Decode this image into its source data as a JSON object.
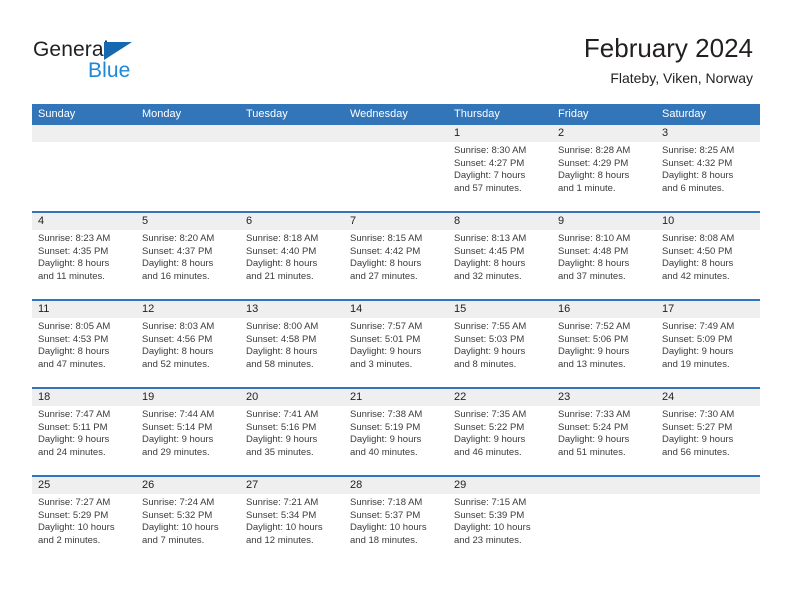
{
  "brand": {
    "word_one": "General",
    "word_two": "Blue",
    "triangle_color": "#1469b0",
    "blue_text_color": "#1d87d8"
  },
  "header": {
    "title": "February 2024",
    "location": "Flateby, Viken, Norway"
  },
  "theme": {
    "header_band": "#3275b8",
    "daynum_band": "#efefef",
    "week_divider": "#3275b8",
    "text": "#231f20"
  },
  "weekday_headers": [
    "Sunday",
    "Monday",
    "Tuesday",
    "Wednesday",
    "Thursday",
    "Friday",
    "Saturday"
  ],
  "weeks": [
    [
      {
        "day": "",
        "sunrise": "",
        "sunset": "",
        "daylight_line1": "",
        "daylight_line2": "",
        "empty": true
      },
      {
        "day": "",
        "sunrise": "",
        "sunset": "",
        "daylight_line1": "",
        "daylight_line2": "",
        "empty": true
      },
      {
        "day": "",
        "sunrise": "",
        "sunset": "",
        "daylight_line1": "",
        "daylight_line2": "",
        "empty": true
      },
      {
        "day": "",
        "sunrise": "",
        "sunset": "",
        "daylight_line1": "",
        "daylight_line2": "",
        "empty": true
      },
      {
        "day": "1",
        "sunrise": "Sunrise: 8:30 AM",
        "sunset": "Sunset: 4:27 PM",
        "daylight_line1": "Daylight: 7 hours",
        "daylight_line2": "and 57 minutes."
      },
      {
        "day": "2",
        "sunrise": "Sunrise: 8:28 AM",
        "sunset": "Sunset: 4:29 PM",
        "daylight_line1": "Daylight: 8 hours",
        "daylight_line2": "and 1 minute."
      },
      {
        "day": "3",
        "sunrise": "Sunrise: 8:25 AM",
        "sunset": "Sunset: 4:32 PM",
        "daylight_line1": "Daylight: 8 hours",
        "daylight_line2": "and 6 minutes."
      }
    ],
    [
      {
        "day": "4",
        "sunrise": "Sunrise: 8:23 AM",
        "sunset": "Sunset: 4:35 PM",
        "daylight_line1": "Daylight: 8 hours",
        "daylight_line2": "and 11 minutes."
      },
      {
        "day": "5",
        "sunrise": "Sunrise: 8:20 AM",
        "sunset": "Sunset: 4:37 PM",
        "daylight_line1": "Daylight: 8 hours",
        "daylight_line2": "and 16 minutes."
      },
      {
        "day": "6",
        "sunrise": "Sunrise: 8:18 AM",
        "sunset": "Sunset: 4:40 PM",
        "daylight_line1": "Daylight: 8 hours",
        "daylight_line2": "and 21 minutes."
      },
      {
        "day": "7",
        "sunrise": "Sunrise: 8:15 AM",
        "sunset": "Sunset: 4:42 PM",
        "daylight_line1": "Daylight: 8 hours",
        "daylight_line2": "and 27 minutes."
      },
      {
        "day": "8",
        "sunrise": "Sunrise: 8:13 AM",
        "sunset": "Sunset: 4:45 PM",
        "daylight_line1": "Daylight: 8 hours",
        "daylight_line2": "and 32 minutes."
      },
      {
        "day": "9",
        "sunrise": "Sunrise: 8:10 AM",
        "sunset": "Sunset: 4:48 PM",
        "daylight_line1": "Daylight: 8 hours",
        "daylight_line2": "and 37 minutes."
      },
      {
        "day": "10",
        "sunrise": "Sunrise: 8:08 AM",
        "sunset": "Sunset: 4:50 PM",
        "daylight_line1": "Daylight: 8 hours",
        "daylight_line2": "and 42 minutes."
      }
    ],
    [
      {
        "day": "11",
        "sunrise": "Sunrise: 8:05 AM",
        "sunset": "Sunset: 4:53 PM",
        "daylight_line1": "Daylight: 8 hours",
        "daylight_line2": "and 47 minutes."
      },
      {
        "day": "12",
        "sunrise": "Sunrise: 8:03 AM",
        "sunset": "Sunset: 4:56 PM",
        "daylight_line1": "Daylight: 8 hours",
        "daylight_line2": "and 52 minutes."
      },
      {
        "day": "13",
        "sunrise": "Sunrise: 8:00 AM",
        "sunset": "Sunset: 4:58 PM",
        "daylight_line1": "Daylight: 8 hours",
        "daylight_line2": "and 58 minutes."
      },
      {
        "day": "14",
        "sunrise": "Sunrise: 7:57 AM",
        "sunset": "Sunset: 5:01 PM",
        "daylight_line1": "Daylight: 9 hours",
        "daylight_line2": "and 3 minutes."
      },
      {
        "day": "15",
        "sunrise": "Sunrise: 7:55 AM",
        "sunset": "Sunset: 5:03 PM",
        "daylight_line1": "Daylight: 9 hours",
        "daylight_line2": "and 8 minutes."
      },
      {
        "day": "16",
        "sunrise": "Sunrise: 7:52 AM",
        "sunset": "Sunset: 5:06 PM",
        "daylight_line1": "Daylight: 9 hours",
        "daylight_line2": "and 13 minutes."
      },
      {
        "day": "17",
        "sunrise": "Sunrise: 7:49 AM",
        "sunset": "Sunset: 5:09 PM",
        "daylight_line1": "Daylight: 9 hours",
        "daylight_line2": "and 19 minutes."
      }
    ],
    [
      {
        "day": "18",
        "sunrise": "Sunrise: 7:47 AM",
        "sunset": "Sunset: 5:11 PM",
        "daylight_line1": "Daylight: 9 hours",
        "daylight_line2": "and 24 minutes."
      },
      {
        "day": "19",
        "sunrise": "Sunrise: 7:44 AM",
        "sunset": "Sunset: 5:14 PM",
        "daylight_line1": "Daylight: 9 hours",
        "daylight_line2": "and 29 minutes."
      },
      {
        "day": "20",
        "sunrise": "Sunrise: 7:41 AM",
        "sunset": "Sunset: 5:16 PM",
        "daylight_line1": "Daylight: 9 hours",
        "daylight_line2": "and 35 minutes."
      },
      {
        "day": "21",
        "sunrise": "Sunrise: 7:38 AM",
        "sunset": "Sunset: 5:19 PM",
        "daylight_line1": "Daylight: 9 hours",
        "daylight_line2": "and 40 minutes."
      },
      {
        "day": "22",
        "sunrise": "Sunrise: 7:35 AM",
        "sunset": "Sunset: 5:22 PM",
        "daylight_line1": "Daylight: 9 hours",
        "daylight_line2": "and 46 minutes."
      },
      {
        "day": "23",
        "sunrise": "Sunrise: 7:33 AM",
        "sunset": "Sunset: 5:24 PM",
        "daylight_line1": "Daylight: 9 hours",
        "daylight_line2": "and 51 minutes."
      },
      {
        "day": "24",
        "sunrise": "Sunrise: 7:30 AM",
        "sunset": "Sunset: 5:27 PM",
        "daylight_line1": "Daylight: 9 hours",
        "daylight_line2": "and 56 minutes."
      }
    ],
    [
      {
        "day": "25",
        "sunrise": "Sunrise: 7:27 AM",
        "sunset": "Sunset: 5:29 PM",
        "daylight_line1": "Daylight: 10 hours",
        "daylight_line2": "and 2 minutes."
      },
      {
        "day": "26",
        "sunrise": "Sunrise: 7:24 AM",
        "sunset": "Sunset: 5:32 PM",
        "daylight_line1": "Daylight: 10 hours",
        "daylight_line2": "and 7 minutes."
      },
      {
        "day": "27",
        "sunrise": "Sunrise: 7:21 AM",
        "sunset": "Sunset: 5:34 PM",
        "daylight_line1": "Daylight: 10 hours",
        "daylight_line2": "and 12 minutes."
      },
      {
        "day": "28",
        "sunrise": "Sunrise: 7:18 AM",
        "sunset": "Sunset: 5:37 PM",
        "daylight_line1": "Daylight: 10 hours",
        "daylight_line2": "and 18 minutes."
      },
      {
        "day": "29",
        "sunrise": "Sunrise: 7:15 AM",
        "sunset": "Sunset: 5:39 PM",
        "daylight_line1": "Daylight: 10 hours",
        "daylight_line2": "and 23 minutes."
      },
      {
        "day": "",
        "sunrise": "",
        "sunset": "",
        "daylight_line1": "",
        "daylight_line2": "",
        "empty": true
      },
      {
        "day": "",
        "sunrise": "",
        "sunset": "",
        "daylight_line1": "",
        "daylight_line2": "",
        "empty": true
      }
    ]
  ]
}
